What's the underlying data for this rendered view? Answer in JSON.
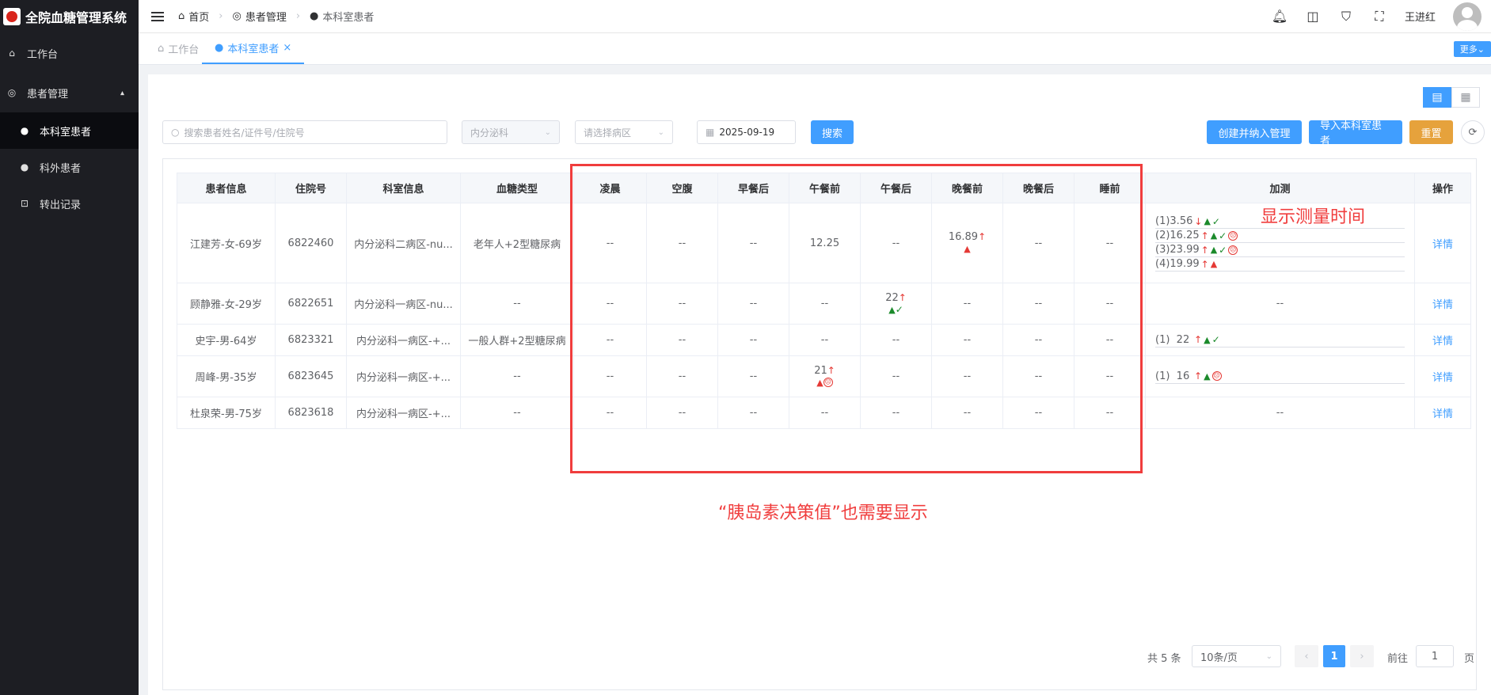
{
  "app": {
    "title": "全院血糖管理系统"
  },
  "sidebar": {
    "items": [
      {
        "label": "工作台",
        "icon": "home-icon"
      },
      {
        "label": "患者管理",
        "icon": "compass-icon"
      },
      {
        "label": "本科室患者",
        "icon": "user-icon"
      },
      {
        "label": "科外患者",
        "icon": "user-icon"
      },
      {
        "label": "转出记录",
        "icon": "cart-icon"
      }
    ]
  },
  "header": {
    "breadcrumb": [
      "首页",
      "患者管理",
      "本科室患者"
    ],
    "username": "王进红"
  },
  "tabs": [
    {
      "label": "工作台"
    },
    {
      "label": "本科室患者"
    }
  ],
  "more_label": "更多",
  "filters": {
    "search_placeholder": "搜索患者姓名/证件号/住院号",
    "department": "内分泌科",
    "ward_placeholder": "请选择病区",
    "date": "2025-09-19",
    "search_btn": "搜索",
    "create_btn": "创建并纳入管理",
    "import_btn": "导入本科室患者",
    "reset_btn": "重置"
  },
  "table": {
    "headers": [
      "患者信息",
      "住院号",
      "科室信息",
      "血糖类型",
      "凌晨",
      "空腹",
      "早餐后",
      "午餐前",
      "午餐后",
      "晚餐前",
      "晚餐后",
      "睡前",
      "加测",
      "操作"
    ],
    "rows": [
      {
        "info": "江建芳-女-69岁",
        "id": "6822460",
        "dept": "内分泌科二病区-nu...",
        "type": "老年人+2型糖尿病",
        "c4": "--",
        "c5": "--",
        "c6": "--",
        "c7": "12.25",
        "c8": "--",
        "c9": "16.89",
        "c10": "--",
        "c11": "--",
        "extra": [
          "(1)3.56",
          "(2)16.25",
          "(3)23.99",
          "(4)19.99"
        ],
        "op": "详情"
      },
      {
        "info": "顾静雅-女-29岁",
        "id": "6822651",
        "dept": "内分泌科一病区-nu...",
        "type": "--",
        "c4": "--",
        "c5": "--",
        "c6": "--",
        "c7": "--",
        "c8": "22",
        "c9": "--",
        "c10": "--",
        "c11": "--",
        "extra_text": "--",
        "op": "详情"
      },
      {
        "info": "史宇-男-64岁",
        "id": "6823321",
        "dept": "内分泌科一病区-+...",
        "type": "一般人群+2型糖尿病",
        "c4": "--",
        "c5": "--",
        "c6": "--",
        "c7": "--",
        "c8": "--",
        "c9": "--",
        "c10": "--",
        "c11": "--",
        "extra": [
          "(1)  22"
        ],
        "op": "详情"
      },
      {
        "info": "周峰-男-35岁",
        "id": "6823645",
        "dept": "内分泌科一病区-+...",
        "type": "--",
        "c4": "--",
        "c5": "--",
        "c6": "--",
        "c7": "21",
        "c8": "--",
        "c9": "--",
        "c10": "--",
        "c11": "--",
        "extra": [
          "(1)  16"
        ],
        "op": "详情"
      },
      {
        "info": "杜泉荣-男-75岁",
        "id": "6823618",
        "dept": "内分泌科一病区-+...",
        "type": "--",
        "c4": "--",
        "c5": "--",
        "c6": "--",
        "c7": "--",
        "c8": "--",
        "c9": "--",
        "c10": "--",
        "c11": "--",
        "extra_text": "--",
        "op": "详情"
      }
    ]
  },
  "annotations": {
    "show_time": "显示测量时间",
    "insulin": "“胰岛素决策值”也需要显示"
  },
  "pagination": {
    "total": "共 5 条",
    "page_size": "10条/页",
    "current": "1",
    "goto_label": "前往",
    "goto_value": "1",
    "page_unit": "页"
  },
  "colors": {
    "primary": "#409eff",
    "warning": "#e6a23c",
    "annotation": "#f03d3d",
    "sidebar": "#1d1e23"
  }
}
